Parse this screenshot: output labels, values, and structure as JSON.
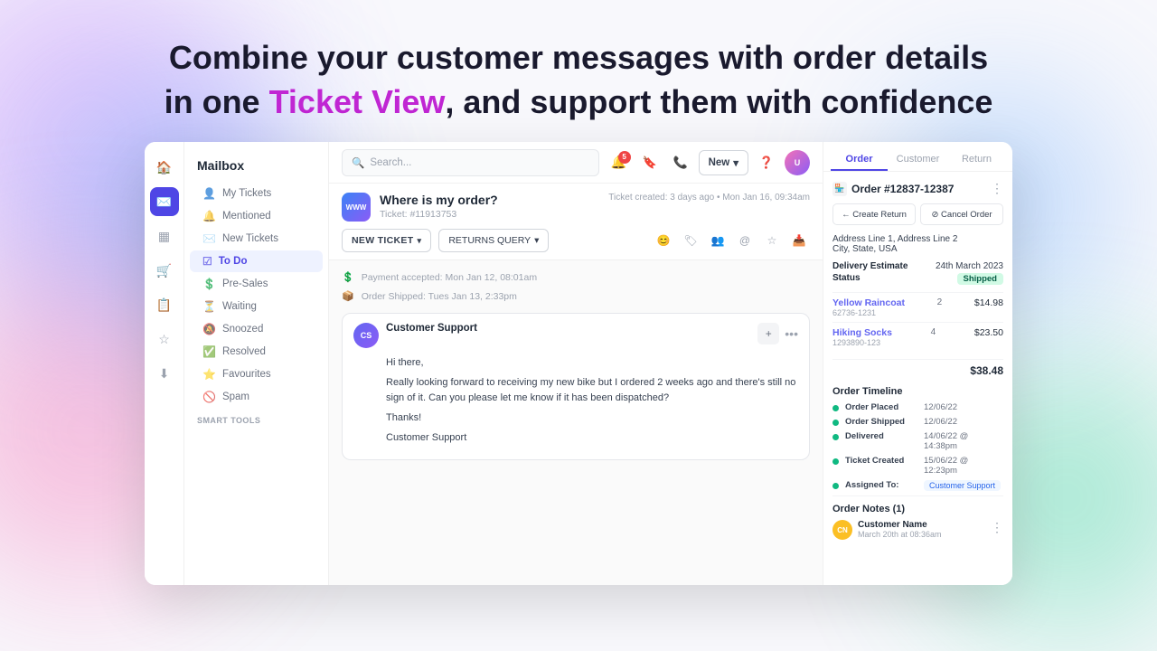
{
  "hero": {
    "line1": "Combine your customer messages with order details",
    "line2_prefix": "in one ",
    "line2_highlight": "Ticket View",
    "line2_suffix": ", and support them with confidence"
  },
  "topbar": {
    "search_placeholder": "Search...",
    "notif_count": "5",
    "new_button": "New"
  },
  "nav": {
    "title": "Mailbox",
    "items": [
      {
        "label": "My Tickets",
        "icon": "👤"
      },
      {
        "label": "Mentioned",
        "icon": "🔔"
      },
      {
        "label": "New Tickets",
        "icon": "✉️"
      },
      {
        "label": "To Do",
        "icon": "☑️",
        "active": true
      },
      {
        "label": "Pre-Sales",
        "icon": "💰"
      },
      {
        "label": "Waiting",
        "icon": "⏳"
      },
      {
        "label": "Snoozed",
        "icon": "🔕"
      },
      {
        "label": "Resolved",
        "icon": "✅"
      },
      {
        "label": "Favourites",
        "icon": "⭐"
      },
      {
        "label": "Spam",
        "icon": "🚫"
      }
    ],
    "smart_tools": "SMART TOOLS"
  },
  "ticket": {
    "subject": "Where is my order?",
    "id": "Ticket: #11913753",
    "meta": "Ticket created: 3 days ago  •  Mon Jan 16, 09:34am",
    "new_ticket_label": "NEW TICKET",
    "returns_query_label": "RETURNS QUERY"
  },
  "message": {
    "avatar": "CS",
    "greeting": "Hi there,",
    "body": "Really looking forward to receiving my new bike but I ordered 2 weeks ago and there's still no sign of it. Can you please let me know if it has been dispatched?",
    "sign_off": "Thanks!",
    "name": "Customer Support"
  },
  "timeline": {
    "payment": "Payment accepted: Mon Jan 12, 08:01am",
    "shipped": "Order Shipped: Tues Jan 13, 2:33pm"
  },
  "panel": {
    "tabs": [
      "Order",
      "Customer",
      "Return"
    ],
    "active_tab": 0,
    "order_number": "Order #12837-12387",
    "actions": [
      "← Create Return",
      "⊘ Cancel Order"
    ],
    "address": "Address Line 1, Address Line 2",
    "city_state": "City, State, USA",
    "delivery_estimate": "24th March 2023",
    "status": "Shipped",
    "items": [
      {
        "name": "Yellow Raincoat",
        "sku": "62736-1231",
        "qty": 2,
        "price": "$14.98"
      },
      {
        "name": "Hiking Socks",
        "sku": "1293890-123",
        "qty": 4,
        "price": "$23.50"
      }
    ],
    "total": "$38.48",
    "timeline_title": "Order Timeline",
    "timeline_events": [
      {
        "label": "Order Placed",
        "date": "12/06/22"
      },
      {
        "label": "Order Shipped",
        "date": "12/06/22"
      },
      {
        "label": "Delivered",
        "date": "14/06/22 @ 14:38pm"
      },
      {
        "label": "Ticket Created",
        "date": "15/06/22 @ 12:23pm"
      },
      {
        "label": "Assigned To:",
        "date": "Customer Support"
      }
    ],
    "notes_title": "Order Notes (1)",
    "note_name": "Customer Name",
    "note_date": "March 20th at 08:36am"
  }
}
